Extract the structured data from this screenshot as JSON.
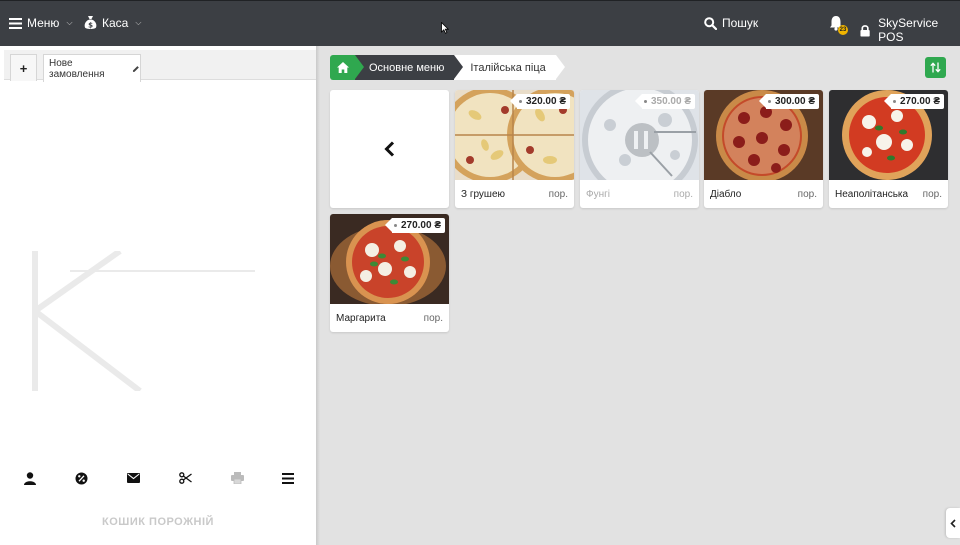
{
  "topbar": {
    "menu_label": "Меню",
    "kasa_label": "Каса",
    "search_label": "Пошук",
    "notification_count": "23",
    "account_label": "SkyService POS"
  },
  "order": {
    "add_tab_label": "+",
    "tab_label": "Нове замовлення",
    "empty_cart_label": "КОШИК ПОРОЖНІЙ"
  },
  "actions": [
    "user-icon",
    "discount-icon",
    "mail-icon",
    "scissors-icon",
    "printer-icon",
    "menu-icon"
  ],
  "breadcrumb": {
    "main": "Основне меню",
    "current": "Італійська піца"
  },
  "colors": {
    "topbar": "#3c3f44",
    "accent_green": "#2fa84f",
    "background": "#e2e2e2"
  },
  "products": [
    {
      "name": "З грушею",
      "price": "320.00 ₴",
      "unit": "пор.",
      "available": true
    },
    {
      "name": "Фунгі",
      "price": "350.00 ₴",
      "unit": "пор.",
      "available": false
    },
    {
      "name": "Діабло",
      "price": "300.00 ₴",
      "unit": "пор.",
      "available": true
    },
    {
      "name": "Неаполітанська",
      "price": "270.00 ₴",
      "unit": "пор.",
      "available": true
    },
    {
      "name": "Маргарита",
      "price": "270.00 ₴",
      "unit": "пор.",
      "available": true
    }
  ]
}
